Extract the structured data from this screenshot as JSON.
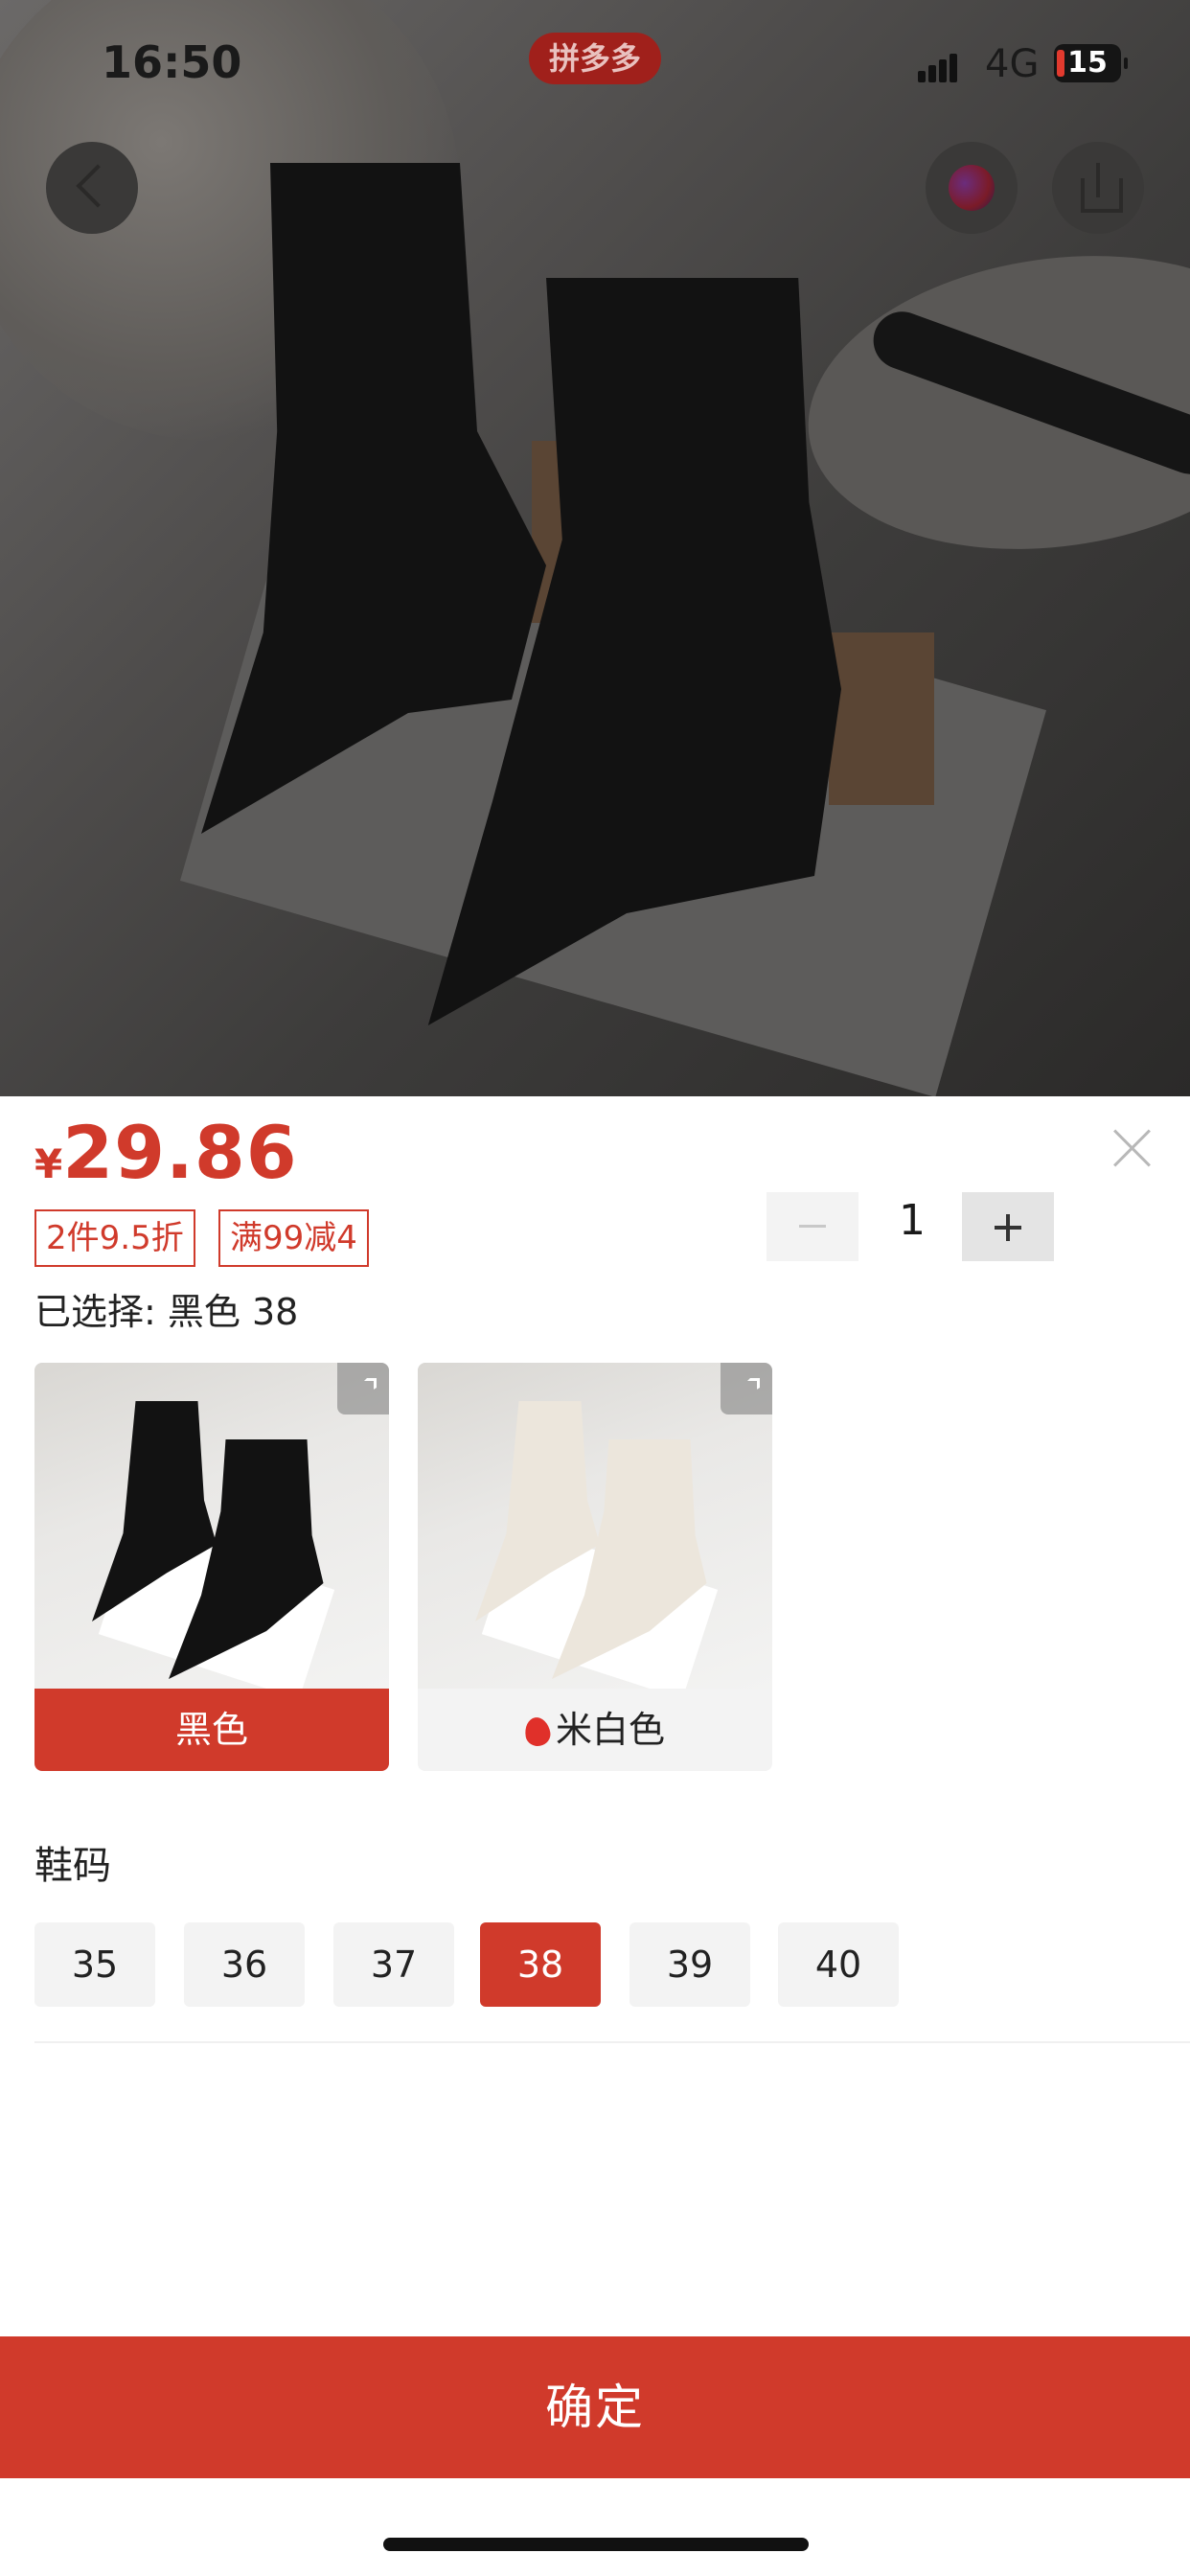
{
  "status_bar": {
    "time": "16:50",
    "app_badge": "拼多多",
    "network": "4G",
    "battery": "15"
  },
  "product": {
    "currency": "¥",
    "price": "29.86"
  },
  "promo_tags": [
    "2件9.5折",
    "满99减4"
  ],
  "quantity": {
    "value": "1"
  },
  "selected_text": "已选择: 黑色 38",
  "colors": [
    {
      "label": "黑色",
      "selected": true
    },
    {
      "label": "米白色",
      "selected": false,
      "hot": true
    }
  ],
  "size_section": {
    "title": "鞋码",
    "sizes": [
      "35",
      "36",
      "37",
      "38",
      "39",
      "40"
    ],
    "selected": "38"
  },
  "confirm_label": "确定",
  "theme": {
    "accent": "#d03a2b"
  }
}
